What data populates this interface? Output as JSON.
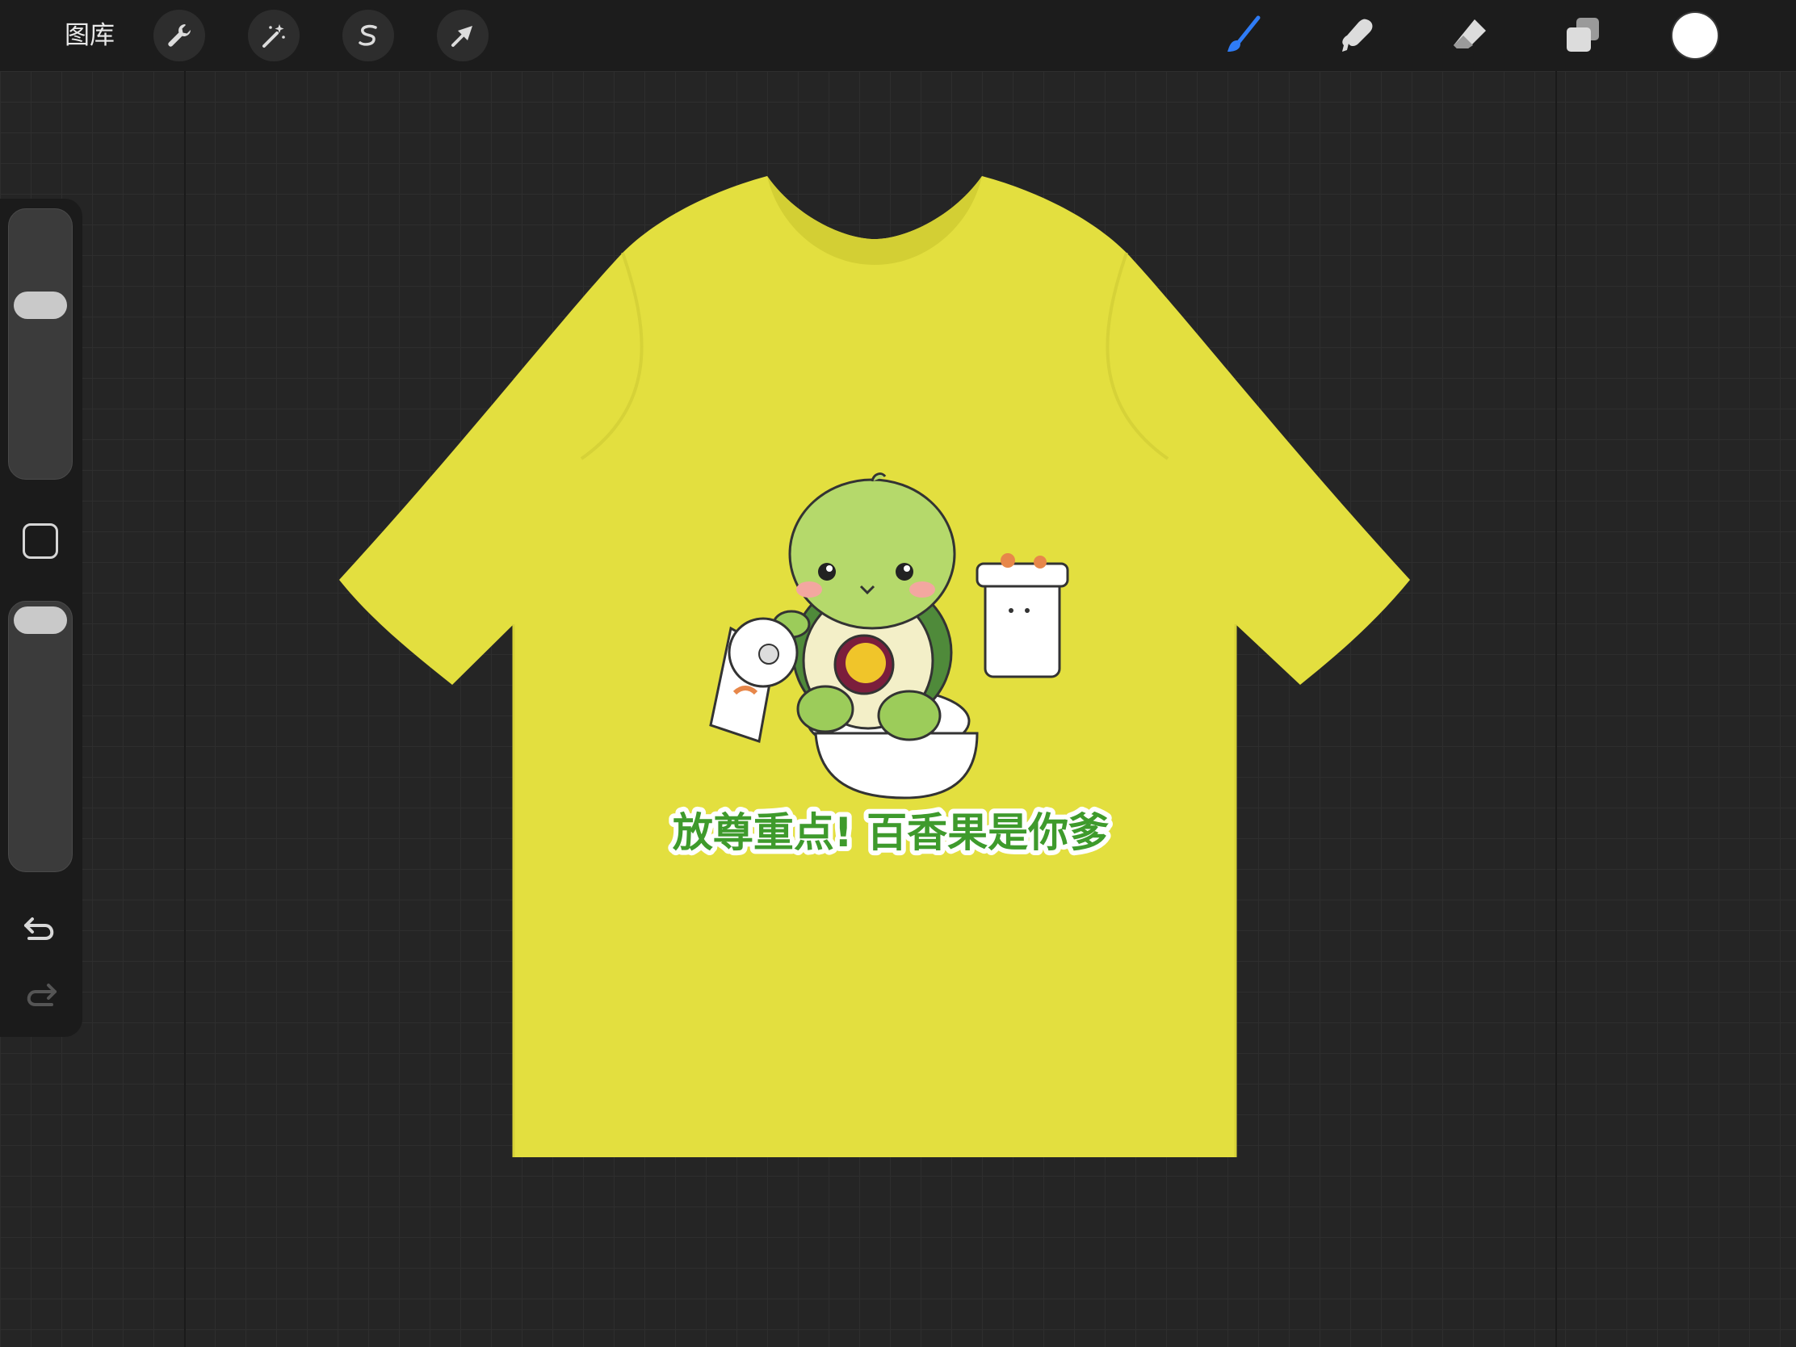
{
  "topbar": {
    "gallery_label": "图库",
    "left_tools": [
      {
        "name": "actions",
        "icon": "wrench-icon"
      },
      {
        "name": "adjustments",
        "icon": "magic-wand-icon"
      },
      {
        "name": "selection",
        "icon": "selection-s-icon"
      },
      {
        "name": "transform",
        "icon": "arrow-cursor-icon"
      }
    ],
    "right_tools": [
      {
        "name": "brush",
        "icon": "brush-icon",
        "active": true
      },
      {
        "name": "smudge",
        "icon": "smudge-icon"
      },
      {
        "name": "eraser",
        "icon": "eraser-icon"
      },
      {
        "name": "layers",
        "icon": "layers-icon"
      }
    ],
    "active_color": "#ffffff",
    "accent": "#2f7cf6"
  },
  "sidebar": {
    "brush_size_level": 0.33,
    "opacity_level": 0.0,
    "modify_icon": "square-icon",
    "undo_icon": "undo-icon",
    "redo_icon": "redo-icon"
  },
  "canvas": {
    "shirt_color": "#e3df3f",
    "print_text": "放尊重点! 百香果是你爹",
    "print_text_color": "#3e9a2c"
  }
}
